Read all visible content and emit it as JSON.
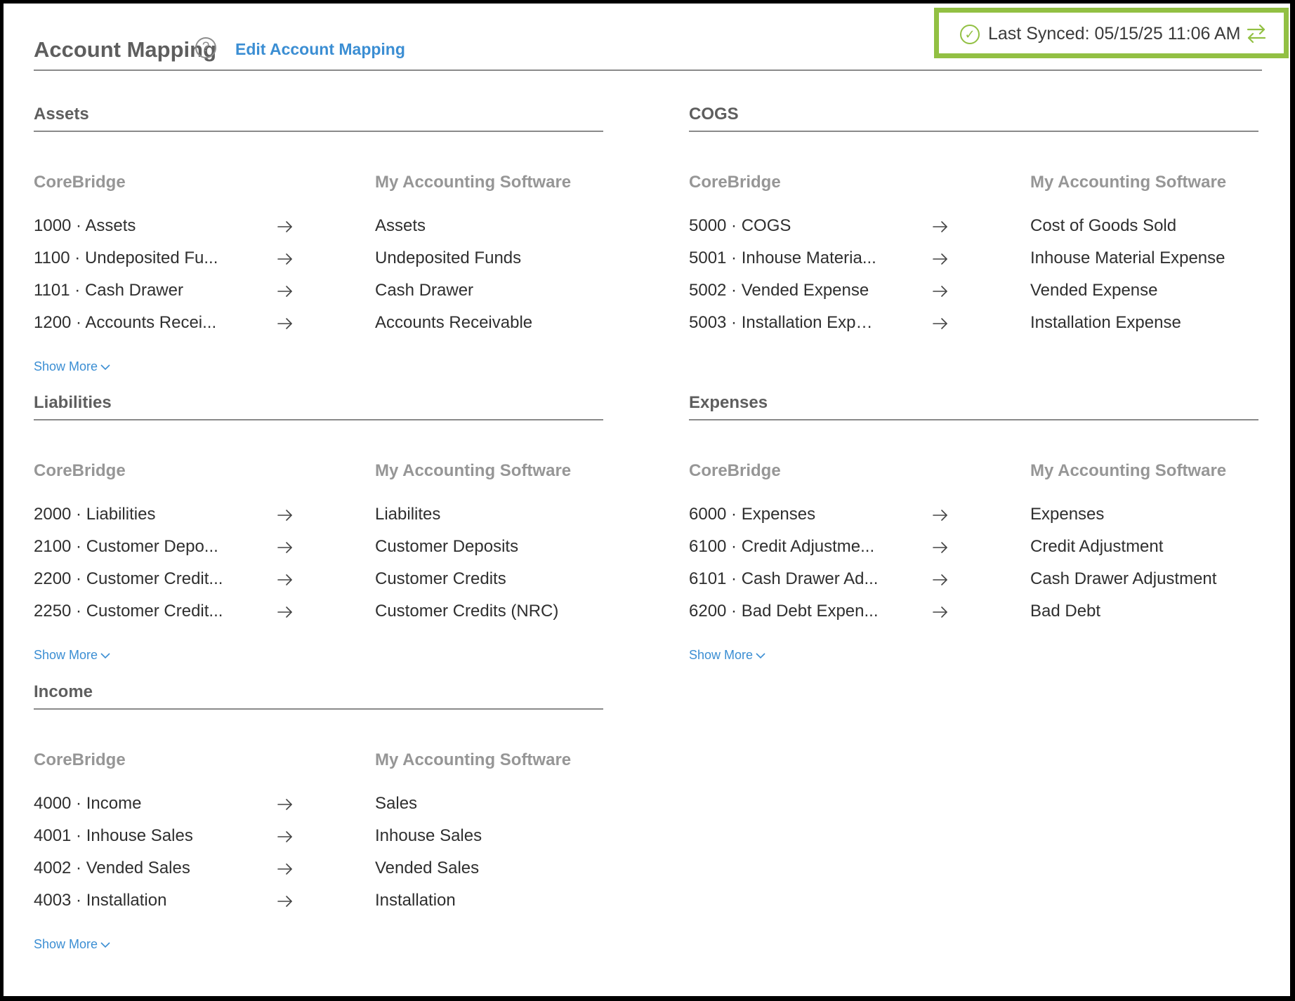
{
  "header": {
    "title": "Account Mapping",
    "help_icon": "?",
    "edit_link": "Edit Account Mapping"
  },
  "sync": {
    "text": "Last Synced: 05/15/25 11:06 AM",
    "check_icon": "✓",
    "accent_color": "#92c043"
  },
  "column_labels": {
    "left": "CoreBridge",
    "right": "My Accounting Software"
  },
  "show_more_label": "Show More",
  "sections": {
    "assets": {
      "title": "Assets",
      "rows": [
        {
          "corebridge": "1000 · Assets",
          "accounting": "Assets"
        },
        {
          "corebridge": "1100 · Undeposited Fu...",
          "accounting": "Undeposited Funds"
        },
        {
          "corebridge": "1101 · Cash Drawer",
          "accounting": "Cash Drawer"
        },
        {
          "corebridge": "1200 · Accounts Recei...",
          "accounting": "Accounts Receivable"
        }
      ]
    },
    "cogs": {
      "title": "COGS",
      "rows": [
        {
          "corebridge": "5000 · COGS",
          "accounting": "Cost of Goods Sold"
        },
        {
          "corebridge": "5001 · Inhouse Materia...",
          "accounting": "Inhouse Material Expense"
        },
        {
          "corebridge": "5002 · Vended Expense",
          "accounting": "Vended Expense"
        },
        {
          "corebridge": "5003 · Installation Expe...",
          "accounting": "Installation Expense"
        }
      ]
    },
    "liabilities": {
      "title": "Liabilities",
      "rows": [
        {
          "corebridge": "2000 · Liabilities",
          "accounting": "Liabilites"
        },
        {
          "corebridge": "2100 · Customer Depo...",
          "accounting": "Customer Deposits"
        },
        {
          "corebridge": "2200 · Customer Credit...",
          "accounting": "Customer Credits"
        },
        {
          "corebridge": "2250 · Customer Credit...",
          "accounting": "Customer Credits (NRC)"
        }
      ]
    },
    "expenses": {
      "title": "Expenses",
      "rows": [
        {
          "corebridge": "6000 · Expenses",
          "accounting": "Expenses"
        },
        {
          "corebridge": "6100 · Credit Adjustme...",
          "accounting": "Credit Adjustment"
        },
        {
          "corebridge": "6101 · Cash Drawer Ad...",
          "accounting": "Cash Drawer Adjustment"
        },
        {
          "corebridge": "6200 · Bad Debt Expen...",
          "accounting": "Bad Debt"
        }
      ]
    },
    "income": {
      "title": "Income",
      "rows": [
        {
          "corebridge": "4000 · Income",
          "accounting": "Sales"
        },
        {
          "corebridge": "4001 · Inhouse Sales",
          "accounting": "Inhouse Sales"
        },
        {
          "corebridge": "4002 · Vended Sales",
          "accounting": "Vended Sales"
        },
        {
          "corebridge": "4003 · Installation",
          "accounting": "Installation"
        }
      ]
    }
  }
}
